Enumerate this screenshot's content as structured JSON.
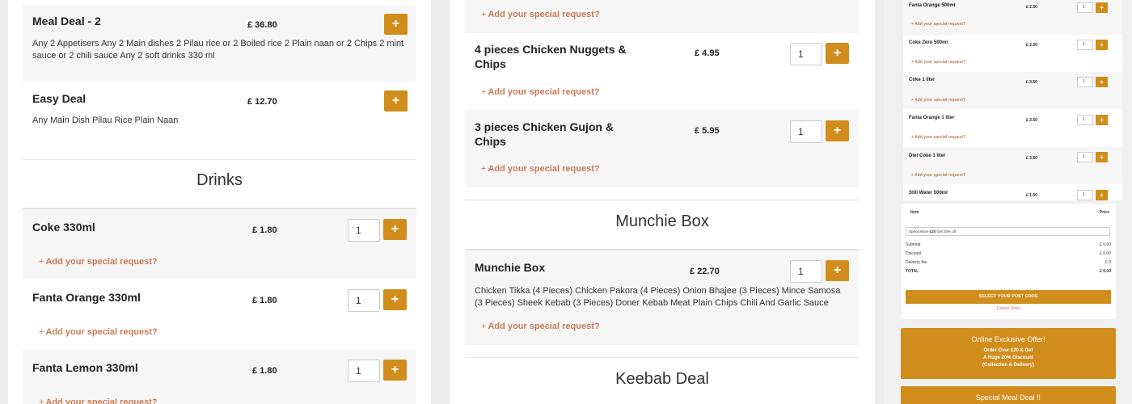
{
  "colors": {
    "accent": "#d08d1c",
    "request_link": "#c77b55"
  },
  "col1": {
    "items": [
      {
        "name": "Meal Deal - 2",
        "price": "£ 36.80",
        "desc": "Any 2 Appetisers Any 2 Main dishes 2 Pilau rice or 2 Boiled rice 2 Plain naan or 2 Chips 2 mint sauce or 2 chili sauce Any 2 soft drinks 330 ml",
        "add": "+"
      },
      {
        "name": "Easy Deal",
        "price": "£ 12.70",
        "desc": "Any Main Dish Pilau Rice Plain Naan",
        "add": "+"
      }
    ],
    "section": "Drinks",
    "drinks": [
      {
        "name": "Coke 330ml",
        "price": "£ 1.80",
        "qty": "1",
        "add": "+",
        "request": "Add your special request?"
      },
      {
        "name": "Fanta Orange 330ml",
        "price": "£ 1.80",
        "qty": "1",
        "add": "+",
        "request": "Add your special request?"
      },
      {
        "name": "Fanta Lemon 330ml",
        "price": "£ 1.80",
        "qty": "1",
        "add": "+",
        "request": "Add your special request?"
      }
    ]
  },
  "col2": {
    "top_request": "Add your special request?",
    "items": [
      {
        "name": "4 pieces Chicken Nuggets & Chips",
        "price": "£ 4.95",
        "qty": "1",
        "add": "+",
        "request": "Add your special request?"
      },
      {
        "name": "3 pieces Chicken Gujon & Chips",
        "price": "£ 5.95",
        "qty": "1",
        "add": "+",
        "request": "Add your special request?"
      }
    ],
    "section1": "Munchie Box",
    "munchie": {
      "name": "Munchie Box",
      "price": "£ 22.70",
      "qty": "1",
      "add": "+",
      "desc": "Chicken Tikka (4 Pieces) Chicken Pakora (4 Pieces) Onion Bhajee (3 Pieces) Mince Samosa (3 Pieces) Sheek Kebab (3 Pieces) Doner Kebab Meat Plain Chips Chili And Garlic Sauce",
      "request": "Add your special request?"
    },
    "section2": "Keebab Deal"
  },
  "col3": {
    "items": [
      {
        "name": "Fanta Orange 500ml",
        "price": "£ 2.50",
        "qty": "1",
        "add": "+",
        "request": "+ Add your special request?"
      },
      {
        "name": "Coke Zero 500ml",
        "price": "£ 2.50",
        "qty": "1",
        "add": "+",
        "request": "+ Add your special request?"
      },
      {
        "name": "Coke 1 liter",
        "price": "£ 3.50",
        "qty": "1",
        "add": "+",
        "request": "+ Add your special request?"
      },
      {
        "name": "Fanta Orange 1 liter",
        "price": "£ 3.50",
        "qty": "1",
        "add": "+",
        "request": "+ Add your special request?"
      },
      {
        "name": "Diet Coke 1 liter",
        "price": "£ 3.50",
        "qty": "1",
        "add": "+",
        "request": "+ Add your special request?"
      },
      {
        "name": "Still Water 500ml",
        "price": "£ 1.50",
        "qty": "1",
        "add": "+"
      }
    ],
    "cart": {
      "item_header": "Item",
      "price_header": "Price",
      "promo_before": "Spend More ",
      "promo_bold": "£20",
      "promo_after": " Get 20% off",
      "rows": [
        {
          "label": "Subtotal",
          "value": "£ 0.00"
        },
        {
          "label": "Discount",
          "value": "£ 0.00"
        },
        {
          "label": "Delivery fee",
          "value": "£ 0"
        },
        {
          "label": "TOTAL",
          "value": "£ 0.00"
        }
      ],
      "select_button": "SELECT YOUR POST CODE",
      "cancel": "Cancel Order"
    },
    "offer": {
      "title": "Online Exclusive Offer!",
      "line1": "Order Over £20 & Get",
      "line2": "A Huge 20% Discount",
      "line3": "(Collection & Delivery)"
    },
    "special": "Special Meal Deal !!"
  }
}
